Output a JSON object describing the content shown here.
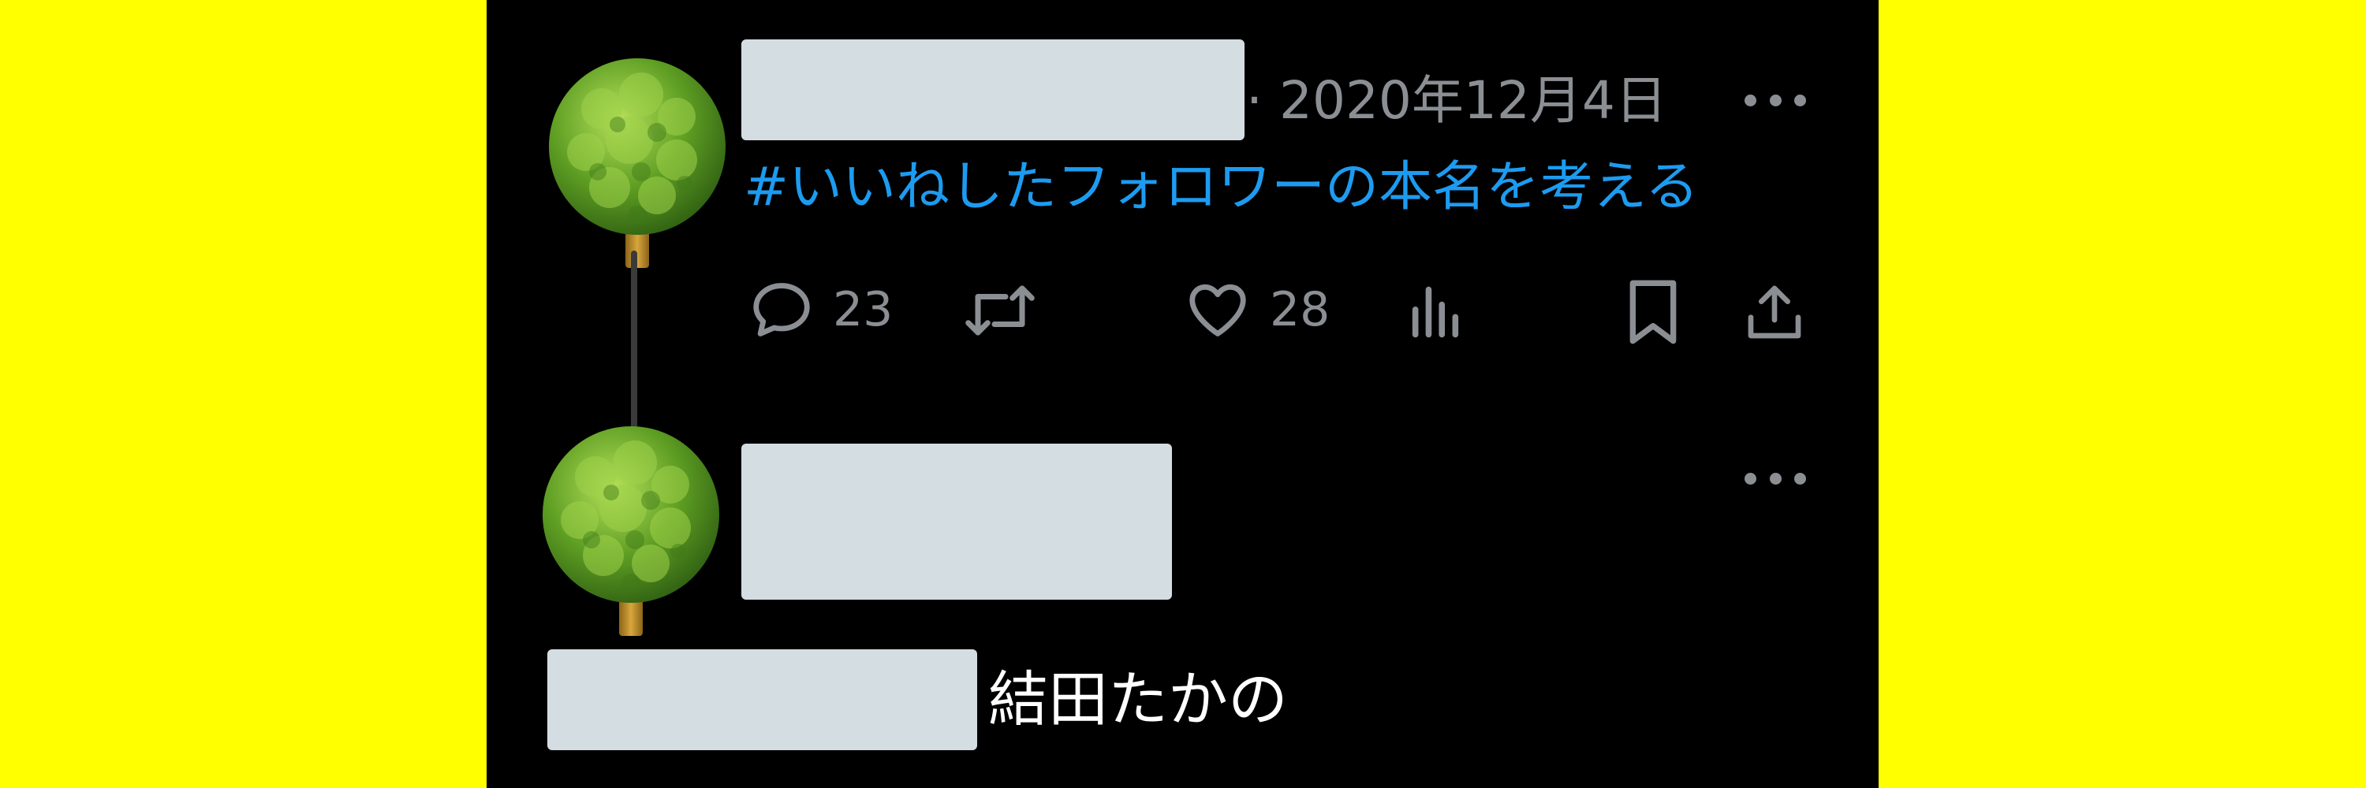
{
  "colors": {
    "background": "#ffff00",
    "panel": "#000000",
    "link": "#1d9bf0",
    "muted": "#8b8f94",
    "redaction": "#d4dde2",
    "text": "#ffffff"
  },
  "tweet": {
    "avatar_icon": "tree-icon",
    "date": "· 2020年12月4日",
    "hashtag": "#いいねしたフォロワーの本名を考える",
    "actions": {
      "reply": {
        "icon": "reply-icon",
        "count": "23"
      },
      "retweet": {
        "icon": "retweet-icon",
        "count": ""
      },
      "like": {
        "icon": "heart-icon",
        "count": "28"
      },
      "views": {
        "icon": "analytics-icon",
        "count": ""
      },
      "bookmark": {
        "icon": "bookmark-icon"
      },
      "share": {
        "icon": "share-icon"
      }
    },
    "more_icon": "more-icon"
  },
  "reply": {
    "avatar_icon": "tree-icon",
    "more_icon": "more-icon",
    "name_suffix": "結田たかの"
  }
}
